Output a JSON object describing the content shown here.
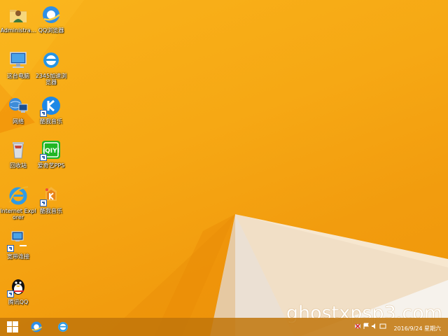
{
  "desktop_icons": [
    {
      "label": "Administra...",
      "icon": "user-folder-icon"
    },
    {
      "label": "QQ浏览器",
      "icon": "qq-browser-icon"
    },
    {
      "label": "这台电脑",
      "icon": "computer-icon"
    },
    {
      "label": "2345加速浏览器",
      "icon": "ie-2345-icon"
    },
    {
      "label": "网络",
      "icon": "network-icon"
    },
    {
      "label": "酷我音乐",
      "icon": "kuwo-music-icon"
    },
    {
      "label": "回收站",
      "icon": "recycle-bin-icon"
    },
    {
      "label": "爱奇艺PPS",
      "icon": "iqiyi-icon"
    },
    {
      "label": "Internet Explorer",
      "icon": "internet-explorer-icon"
    },
    {
      "label": "酷我音乐",
      "icon": "kuwo-box-icon"
    },
    {
      "label": "宽带连接",
      "icon": "broadband-icon"
    },
    {
      "label": "腾讯QQ",
      "icon": "qq-penguin-icon"
    }
  ],
  "watermark": "ghostxpsp3.com",
  "taskbar": {
    "pinned": [
      "start-icon",
      "qq-browser-icon",
      "internet-explorer-icon"
    ]
  },
  "clock": {
    "date": "2016/9/24 星期六"
  },
  "colors": {
    "wallpaper": "#f6a814",
    "taskbar": "#c1760a",
    "label_text": "#ffffff"
  }
}
